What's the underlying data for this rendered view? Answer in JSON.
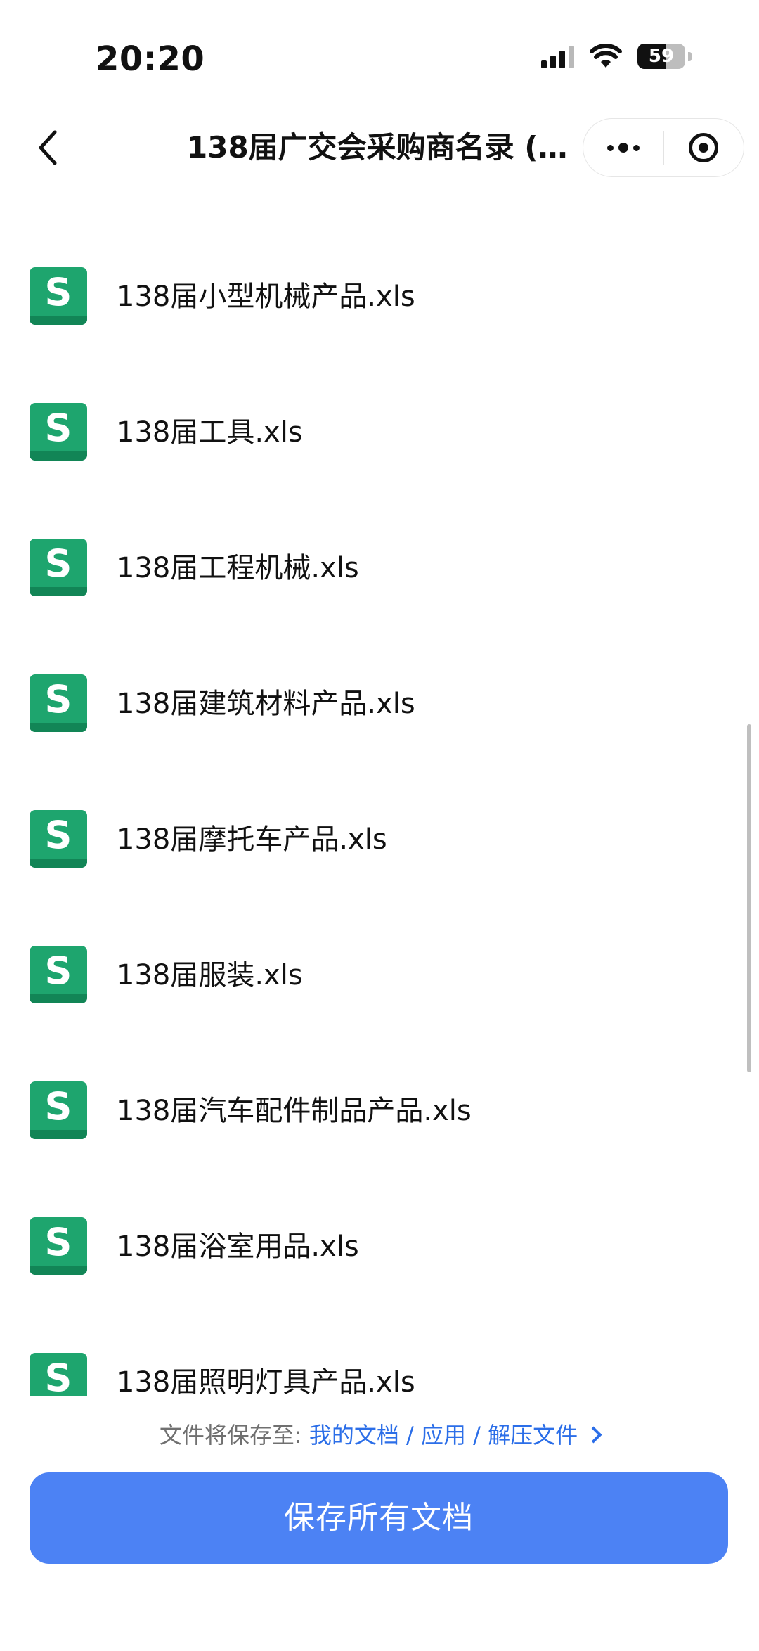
{
  "status_bar": {
    "time": "20:20",
    "battery": "59",
    "icons": [
      "cellular-signal-icon",
      "wifi-icon",
      "battery-icon"
    ]
  },
  "nav": {
    "title": "138届广交会采购商名录 (1...",
    "back_icon": "chevron-left-icon",
    "more_icon": "more-dots-icon",
    "close_icon": "target-circle-icon"
  },
  "file_icon": {
    "letter": "S",
    "color": "#1ea56e",
    "shade": "#128556"
  },
  "files": [
    {
      "name": "138届小型机械产品.xls"
    },
    {
      "name": "138届工具.xls"
    },
    {
      "name": "138届工程机械.xls"
    },
    {
      "name": "138届建筑材料产品.xls"
    },
    {
      "name": "138届摩托车产品.xls"
    },
    {
      "name": "138届服装.xls"
    },
    {
      "name": "138届汽车配件制品产品.xls"
    },
    {
      "name": "138届浴室用品.xls"
    },
    {
      "name": "138届照明灯具产品.xls"
    }
  ],
  "save_path": {
    "label": "文件将保存至:",
    "link": "我的文档 / 应用 / 解压文件"
  },
  "save_all_label": "保存所有文档",
  "colors": {
    "accent": "#4c82f4",
    "link": "#2b6ee8"
  }
}
